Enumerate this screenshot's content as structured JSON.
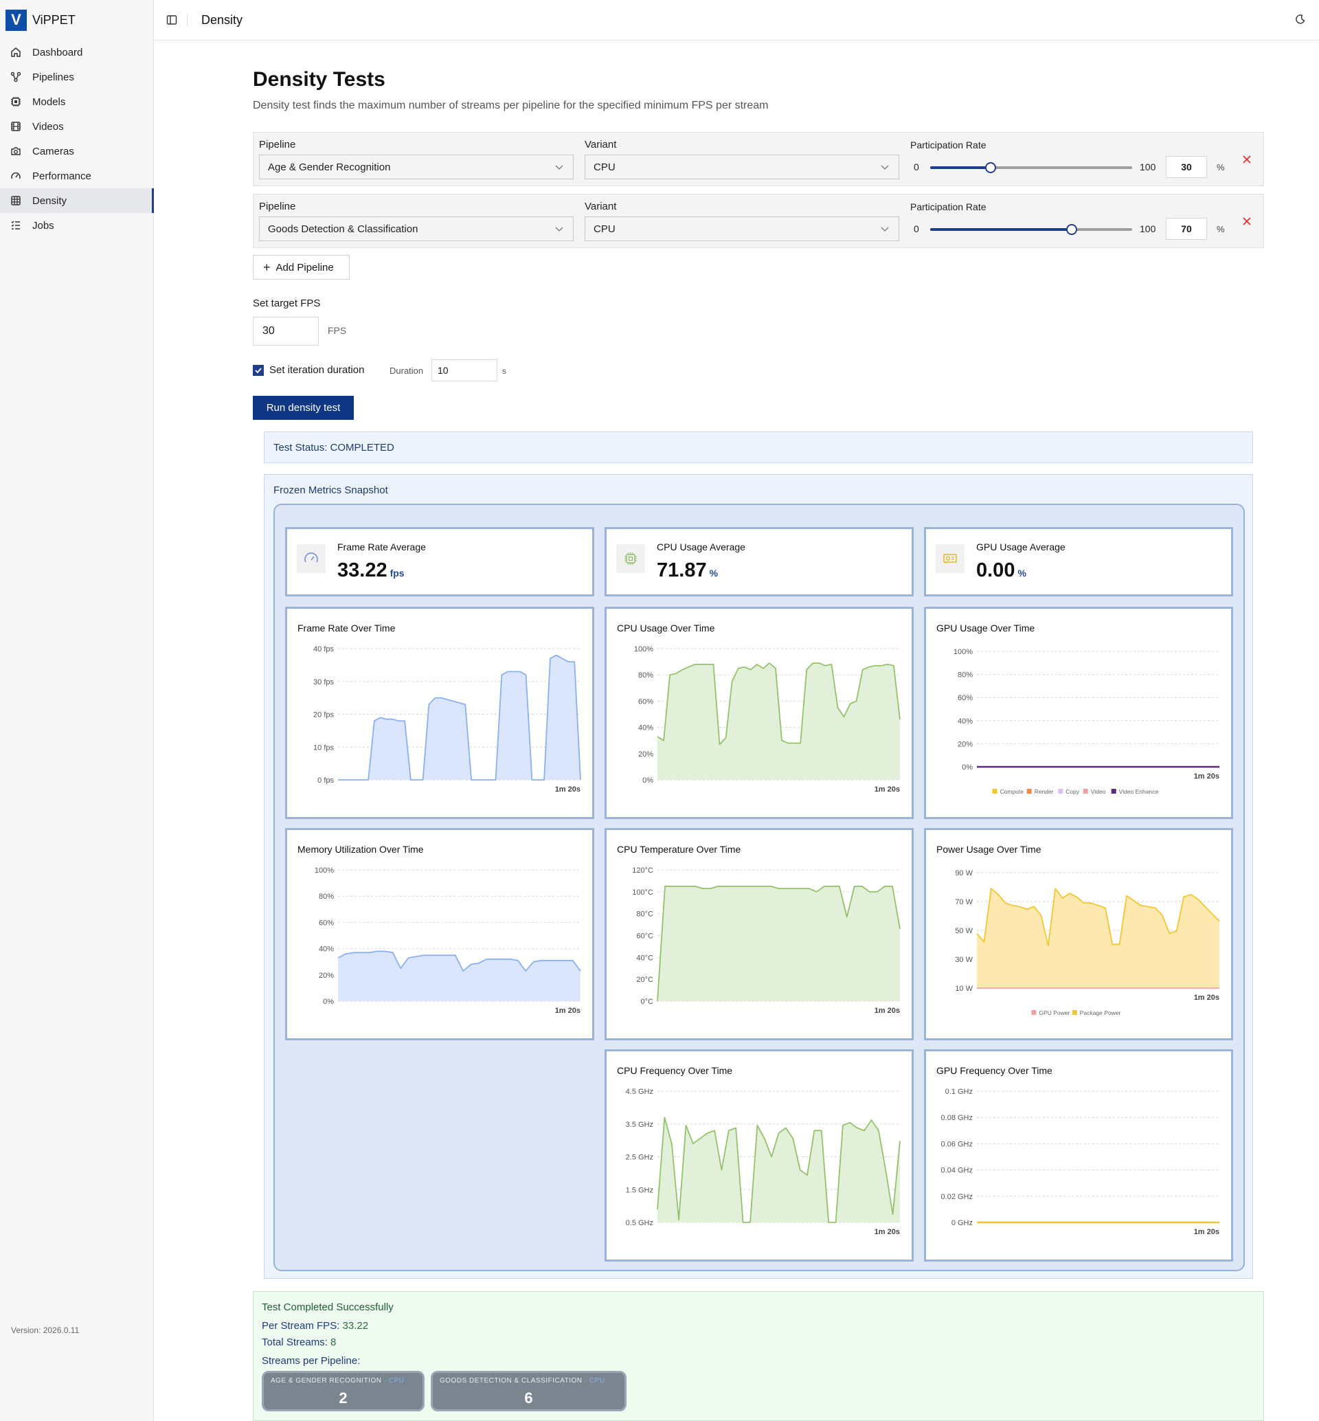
{
  "app": {
    "name": "ViPPET",
    "logo_letter": "V",
    "version": "Version: 2026.0.11"
  },
  "sidebar": {
    "items": [
      {
        "label": "Dashboard",
        "icon": "home-icon",
        "active": false
      },
      {
        "label": "Pipelines",
        "icon": "workflow-icon",
        "active": false
      },
      {
        "label": "Models",
        "icon": "chip-icon",
        "active": false
      },
      {
        "label": "Videos",
        "icon": "film-icon",
        "active": false
      },
      {
        "label": "Cameras",
        "icon": "camera-icon",
        "active": false
      },
      {
        "label": "Performance",
        "icon": "gauge-icon",
        "active": false
      },
      {
        "label": "Density",
        "icon": "grid-icon",
        "active": true
      },
      {
        "label": "Jobs",
        "icon": "list-icon",
        "active": false
      }
    ]
  },
  "header": {
    "title": "Density"
  },
  "page": {
    "title": "Density Tests",
    "description": "Density test finds the maximum number of streams per pipeline for the specified minimum FPS per stream"
  },
  "pipelines": [
    {
      "pipeline_label": "Pipeline",
      "pipeline_value": "Age & Gender Recognition",
      "variant_label": "Variant",
      "variant_value": "CPU",
      "rate_label": "Participation Rate",
      "min": "0",
      "max": "100",
      "rate": 30,
      "rate_text": "30",
      "unit": "%"
    },
    {
      "pipeline_label": "Pipeline",
      "pipeline_value": "Goods Detection & Classification",
      "variant_label": "Variant",
      "variant_value": "CPU",
      "rate_label": "Participation Rate",
      "min": "0",
      "max": "100",
      "rate": 70,
      "rate_text": "70",
      "unit": "%"
    }
  ],
  "controls": {
    "add_pipeline": "Add Pipeline",
    "fps_label": "Set target FPS",
    "fps_value": "30",
    "fps_unit": "FPS",
    "iteration_label": "Set iteration duration",
    "iteration_checked": true,
    "duration_label": "Duration",
    "duration_value": "10",
    "duration_unit": "s",
    "run_button": "Run density test"
  },
  "status": {
    "text": "Test Status: COMPLETED"
  },
  "metrics": {
    "title": "Frozen Metrics Snapshot",
    "stats": [
      {
        "label": "Frame Rate Average",
        "value": "33.22",
        "unit": "fps",
        "icon": "gauge-icon"
      },
      {
        "label": "CPU Usage Average",
        "value": "71.87",
        "unit": "%",
        "icon": "cpu-icon"
      },
      {
        "label": "GPU Usage Average",
        "value": "0.00",
        "unit": "%",
        "icon": "gpu-icon"
      }
    ]
  },
  "colors": {
    "blue": "#8ab0f2",
    "blue_fill": "#dbe6fc",
    "green": "#93c26a",
    "green_fill": "#e3f0d9",
    "yellow": "#f2c631",
    "yellow_fill": "#fde9b0",
    "pink": "#f0a0a4",
    "purple": "#5a2a78",
    "nav_accent": "#1e3a8a",
    "run_button": "#103784"
  },
  "chart_data": [
    {
      "title": "Frame Rate Over Time",
      "type": "area",
      "yticks": [
        "0 fps",
        "10 fps",
        "20 fps",
        "30 fps",
        "40 fps"
      ],
      "ylim": [
        0,
        40
      ],
      "xlabel_end": "1m 20s",
      "series": [
        {
          "values": [
            0,
            0,
            0,
            0,
            0,
            0,
            18,
            19,
            18.5,
            18.5,
            18,
            18,
            0,
            0,
            0,
            23,
            25,
            25,
            24.5,
            24,
            23.5,
            23,
            0,
            0,
            0,
            0,
            0,
            32,
            33,
            33,
            33,
            32,
            0,
            0,
            0,
            37,
            38,
            37,
            36,
            36,
            0
          ]
        }
      ]
    },
    {
      "title": "CPU Usage Over Time",
      "type": "area",
      "yticks": [
        "0%",
        "20%",
        "40%",
        "60%",
        "80%",
        "100%"
      ],
      "ylim": [
        0,
        100
      ],
      "xlabel_end": "1m 20s",
      "series": [
        {
          "values": [
            33,
            30,
            80,
            81,
            84,
            86,
            88,
            88,
            88,
            88,
            27,
            32,
            75,
            85,
            86,
            84,
            88,
            85,
            89,
            85,
            30,
            28,
            28,
            28,
            84,
            89,
            89,
            87,
            88,
            55,
            48,
            58,
            60,
            84,
            86,
            87,
            87,
            88,
            87,
            46
          ]
        }
      ]
    },
    {
      "title": "GPU Usage Over Time",
      "type": "line",
      "yticks": [
        "0%",
        "20%",
        "40%",
        "60%",
        "80%",
        "100%"
      ],
      "ylim": [
        0,
        100
      ],
      "xlabel_end": "1m 20s",
      "legend": [
        "Compute",
        "Render",
        "Copy",
        "Video",
        "Video Enhance"
      ],
      "legend_colors": [
        "#f2c631",
        "#ef8a4a",
        "#d9c2f0",
        "#f0a0a4",
        "#5a2a78"
      ],
      "series": [
        {
          "name": "Video Enhance",
          "values": [
            0,
            0
          ]
        }
      ]
    },
    {
      "title": "Memory Utilization Over Time",
      "type": "area",
      "yticks": [
        "0%",
        "20%",
        "40%",
        "60%",
        "80%",
        "100%"
      ],
      "ylim": [
        0,
        100
      ],
      "xlabel_end": "1m 20s",
      "series": [
        {
          "values": [
            33,
            36,
            37,
            37,
            37,
            38,
            38,
            37,
            25,
            33,
            34,
            35,
            35,
            35,
            35,
            35,
            23,
            28,
            29,
            32,
            32,
            32,
            32,
            31,
            23,
            30,
            31,
            31,
            31,
            31,
            31,
            23
          ]
        }
      ]
    },
    {
      "title": "CPU Temperature Over Time",
      "type": "area",
      "yticks": [
        "0°C",
        "20°C",
        "40°C",
        "60°C",
        "80°C",
        "100°C",
        "120°C"
      ],
      "ylim": [
        0,
        120
      ],
      "xlabel_end": "1m 20s",
      "series": [
        {
          "values": [
            0,
            105,
            105,
            105,
            105,
            105,
            103,
            103,
            105,
            105,
            105,
            105,
            105,
            105,
            105,
            105,
            103,
            103,
            103,
            103,
            103,
            100,
            105,
            105,
            105,
            77,
            105,
            105,
            100,
            100,
            105,
            105,
            66
          ]
        }
      ]
    },
    {
      "title": "Power Usage Over Time",
      "type": "area",
      "yticks": [
        "10 W",
        "30 W",
        "50 W",
        "70 W",
        "90 W"
      ],
      "ylim": [
        0,
        95
      ],
      "xlabel_end": "1m 20s",
      "legend": [
        "GPU Power",
        "Package Power"
      ],
      "legend_colors": [
        "#f0a0a4",
        "#f2c631"
      ],
      "series": [
        {
          "name": "Package Power",
          "values": [
            45,
            38,
            82,
            77,
            70,
            68,
            67,
            65,
            67,
            60,
            35,
            82,
            74,
            78,
            75,
            70,
            70,
            68,
            66,
            36,
            36,
            76,
            72,
            68,
            67,
            66,
            60,
            45,
            47,
            75,
            77,
            73,
            67,
            61,
            55
          ]
        },
        {
          "name": "GPU Power",
          "values": [
            0,
            0
          ]
        }
      ]
    },
    {
      "title": "CPU Frequency Over Time",
      "type": "area",
      "yticks": [
        "0.5 GHz",
        "1.5 GHz",
        "2.5 GHz",
        "3.5 GHz",
        "4.5 GHz"
      ],
      "ylim": [
        0,
        5
      ],
      "xlabel_end": "1m 20s",
      "series": [
        {
          "values": [
            0.5,
            4,
            3,
            0.1,
            3.7,
            3,
            3.2,
            3.4,
            3.5,
            2,
            3.5,
            3.6,
            0,
            0,
            3.7,
            3.2,
            2.5,
            3.4,
            3.6,
            3.2,
            2,
            1.8,
            3.5,
            3.5,
            0,
            0,
            3.7,
            3.8,
            3.6,
            3.5,
            3.9,
            3.5,
            2,
            0.3,
            3.1
          ]
        }
      ]
    },
    {
      "title": "GPU Frequency Over Time",
      "type": "line",
      "yticks": [
        "0 GHz",
        "0.02 GHz",
        "0.04 GHz",
        "0.06 GHz",
        "0.08 GHz",
        "0.1 GHz"
      ],
      "ylim": [
        0,
        0.1
      ],
      "xlabel_end": "1m 20s",
      "series": [
        {
          "values": [
            0,
            0
          ]
        }
      ]
    }
  ],
  "result": {
    "title": "Test Completed Successfully",
    "per_stream_fps_label": "Per Stream FPS:",
    "per_stream_fps": "33.22",
    "total_streams_label": "Total Streams:",
    "total_streams": "8",
    "streams_label": "Streams per Pipeline:",
    "streams": [
      {
        "name": "AGE & GENDER RECOGNITION",
        "variant": "CPU",
        "count": "2"
      },
      {
        "name": "GOODS DETECTION & CLASSIFICATION",
        "variant": "CPU",
        "count": "6"
      }
    ]
  }
}
